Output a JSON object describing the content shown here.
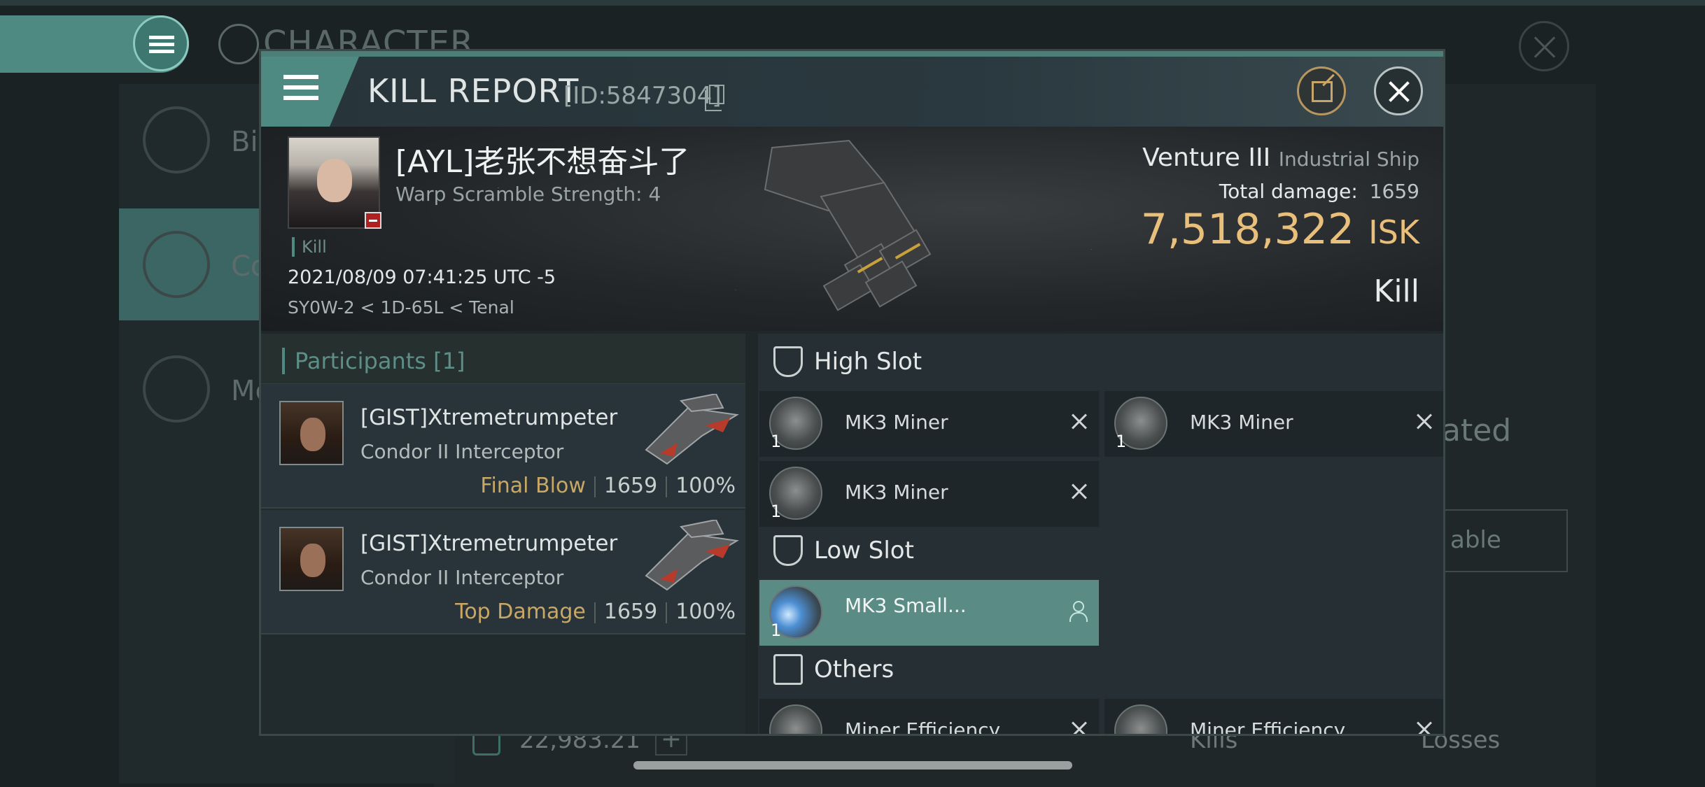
{
  "background": {
    "title": "CHARACTER",
    "sidebar": [
      {
        "label": "Bio"
      },
      {
        "label": "Co"
      },
      {
        "label": "Me"
      }
    ],
    "right_text": "ated",
    "right_button": "able",
    "bottom_value": "22,983.21",
    "bottom_kills": "Kills",
    "bottom_losses": "Losses"
  },
  "modal": {
    "title": "KILL REPORT",
    "id_text": "[ID:5847304]",
    "victim": {
      "name": "[AYL]老张不想奋斗了",
      "subtitle": "Warp Scramble Strength: 4",
      "tag": "Kill",
      "time": "2021/08/09 07:41:25 UTC -5",
      "location": "SY0W-2 < 1D-65L < Tenal"
    },
    "ship": {
      "name": "Venture III",
      "class": "Industrial Ship",
      "damage_label": "Total damage:",
      "damage_value": "1659",
      "isk_value": "7,518,322",
      "isk_unit": "ISK",
      "result": "Kill"
    },
    "participants": {
      "header": "Participants [1]",
      "rows": [
        {
          "name": "[GIST]Xtremetrumpeter",
          "ship": "Condor II Interceptor",
          "role": "Final Blow",
          "damage": "1659",
          "percent": "100%"
        },
        {
          "name": "[GIST]Xtremetrumpeter",
          "ship": "Condor II Interceptor",
          "role": "Top Damage",
          "damage": "1659",
          "percent": "100%"
        }
      ]
    },
    "slots": {
      "high": {
        "label": "High Slot",
        "items": [
          {
            "name": "MK3 Miner",
            "qty": "1"
          },
          {
            "name": "MK3 Miner",
            "qty": "1"
          },
          {
            "name": "MK3 Miner",
            "qty": "1"
          }
        ]
      },
      "low": {
        "label": "Low Slot",
        "items": [
          {
            "name": "MK3 Small...",
            "qty": "1"
          }
        ]
      },
      "others": {
        "label": "Others",
        "items": [
          {
            "name": "Miner Efficiency..."
          },
          {
            "name": "Miner Efficiency..."
          }
        ]
      }
    }
  }
}
